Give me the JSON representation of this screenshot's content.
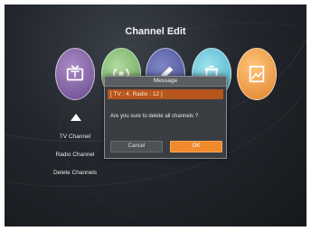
{
  "screen": {
    "title": "Channel Edit"
  },
  "icons": [
    {
      "name": "tv-icon",
      "color": "#7b5aa0"
    },
    {
      "name": "radio-icon",
      "color": "#6fae5a"
    },
    {
      "name": "edit-icon",
      "color": "#4a56a0"
    },
    {
      "name": "trash-icon",
      "color": "#4ab8cf"
    },
    {
      "name": "picture-icon",
      "color": "#ee9436"
    }
  ],
  "menu": {
    "items": [
      "TV Channel",
      "Radio Channel",
      "Delete Channels"
    ]
  },
  "dialog": {
    "title": "Message",
    "info": "[ TV : 4,  Radio : 12 ]",
    "message": "Are you sure to delete all channels ?",
    "cancel_label": "Cancel",
    "ok_label": "OK"
  },
  "colors": {
    "accent": "#f08a2c",
    "info_bar": "#b6561c"
  }
}
